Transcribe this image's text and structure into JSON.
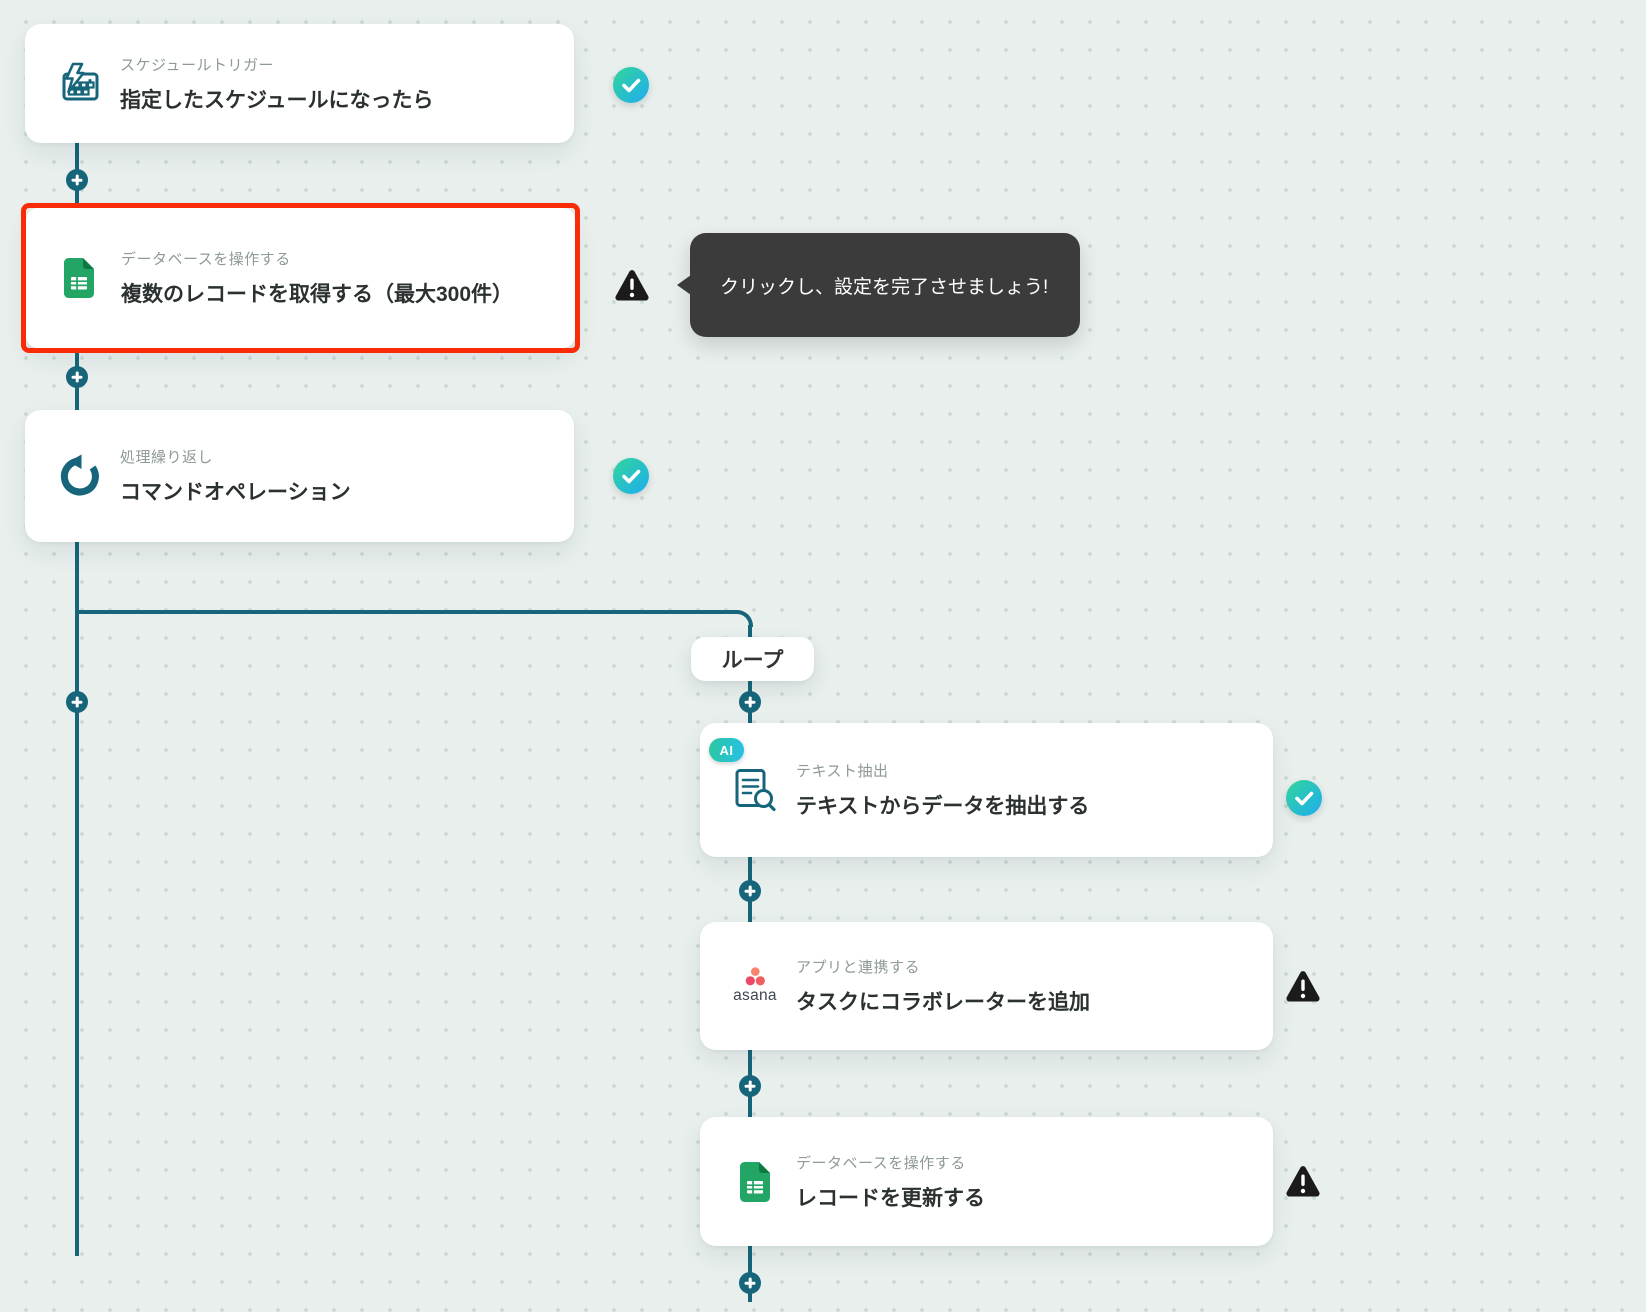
{
  "workflow": {
    "background_color": "#e8efed",
    "dot_color": "#ccd9d5",
    "colors": {
      "connector_teal": "#16657a",
      "highlight_red": "#fa2c08",
      "tooltip_bg": "#3b3b3b",
      "check_gradient_start": "#31d2a0",
      "check_gradient_end": "#1fb0e9",
      "warning_black": "#1b1b1b",
      "sheets_green": "#22a565",
      "sheets_fold_green": "#0e7a43",
      "asana_coral_top": "#f9836d",
      "asana_coral_left": "#ee4964",
      "asana_coral_right": "#f15c62"
    },
    "loop_branch_label": "ループ",
    "tooltip": {
      "text": "クリックし、設定を完了させましょう!"
    },
    "nodes": [
      {
        "category": "スケジュールトリガー",
        "title": "指定したスケジュールになったら",
        "icon": "schedule-trigger-calendar-icon",
        "status": "completed"
      },
      {
        "category": "データベースを操作する",
        "title": "複数のレコードを取得する（最大300件）",
        "icon": "google-sheets-icon",
        "status": "warning",
        "highlighted": true
      },
      {
        "category": "処理繰り返し",
        "title": "コマンドオペレーション",
        "icon": "loop-repeat-icon",
        "status": "completed"
      },
      {
        "category": "テキスト抽出",
        "title": "テキストからデータを抽出する",
        "icon": "text-extract-document-icon",
        "status": "completed",
        "badge": "AI"
      },
      {
        "category": "アプリと連携する",
        "title": "タスクにコラボレーターを追加",
        "icon": "asana-logo",
        "status": "warning",
        "app_wordmark": "asana"
      },
      {
        "category": "データベースを操作する",
        "title": "レコードを更新する",
        "icon": "google-sheets-icon",
        "status": "warning"
      }
    ]
  }
}
